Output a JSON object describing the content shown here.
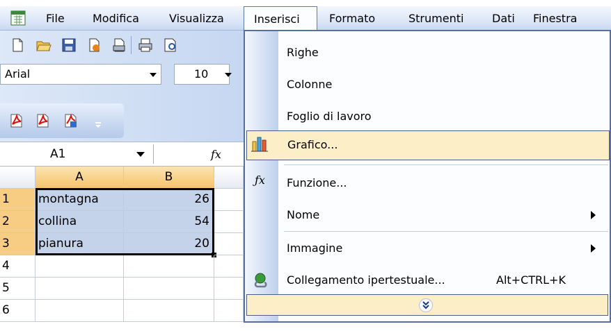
{
  "menubar": {
    "items": [
      {
        "label": "File"
      },
      {
        "label": "Modifica"
      },
      {
        "label": "Visualizza"
      },
      {
        "label": "Inserisci"
      },
      {
        "label": "Formato"
      },
      {
        "label": "Strumenti"
      },
      {
        "label": "Dati"
      },
      {
        "label": "Finestra"
      }
    ]
  },
  "toolbar": {
    "font_name": "Arial",
    "font_size": "10"
  },
  "formula_bar": {
    "name_box": "A1",
    "fx_label": "fx"
  },
  "sheet": {
    "columns": [
      "A",
      "B"
    ],
    "rows": [
      "1",
      "2",
      "3",
      "4",
      "5",
      "6"
    ],
    "cells": [
      {
        "a": "montagna",
        "b": "26"
      },
      {
        "a": "collina",
        "b": "54"
      },
      {
        "a": "pianura",
        "b": "20"
      }
    ]
  },
  "insert_menu": {
    "items": [
      {
        "label": "Righe"
      },
      {
        "label": "Colonne"
      },
      {
        "label": "Foglio di lavoro"
      },
      {
        "label": "Grafico..."
      },
      {
        "label": "Funzione..."
      },
      {
        "label": "Nome"
      },
      {
        "label": "Immagine"
      },
      {
        "label": "Collegamento ipertestuale...",
        "shortcut": "Alt+CTRL+K"
      }
    ],
    "expand_icon": "double-chevron-down-icon"
  },
  "colors": {
    "menubar": "#d9e4f6",
    "highlight": "#fcefc8",
    "selection": "#c5d3ea",
    "header_selected": "#f6c36a"
  }
}
